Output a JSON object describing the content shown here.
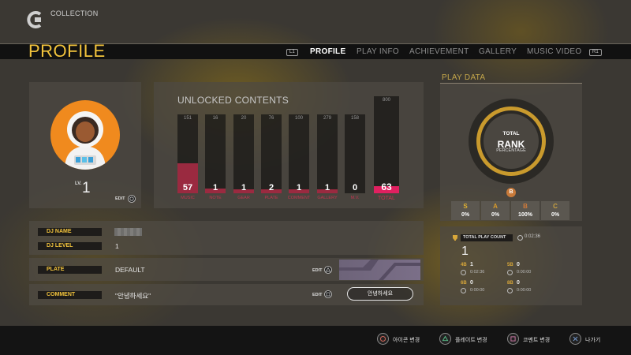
{
  "header": {
    "collection_label": "COLLECTION",
    "page_title": "PROFILE",
    "nav_left_button": "L1",
    "nav_right_button": "R1",
    "tabs": [
      {
        "label": "PROFILE",
        "active": true
      },
      {
        "label": "PLAY INFO",
        "active": false
      },
      {
        "label": "ACHIEVEMENT",
        "active": false
      },
      {
        "label": "GALLERY",
        "active": false
      },
      {
        "label": "MUSIC VIDEO",
        "active": false
      }
    ]
  },
  "profile": {
    "lv_label": "LV.",
    "level": "1",
    "edit_label": "EDIT",
    "avatar_icon": "astronaut-avatar"
  },
  "unlocked": {
    "title": "UNLOCKED CONTENTS",
    "chart_data": {
      "type": "bar",
      "categories": [
        "MUSIC",
        "NOTE",
        "GEAR",
        "PLATE",
        "COMMENT",
        "GALLERY",
        "M.V.",
        "TOTAL"
      ],
      "max_values": [
        151,
        16,
        20,
        76,
        100,
        279,
        158,
        800
      ],
      "values": [
        57,
        1,
        1,
        2,
        1,
        1,
        0,
        63
      ],
      "bar_color": "#9a2a40",
      "total_color": "#e02060"
    }
  },
  "info": {
    "dj_name_label": "DJ NAME",
    "dj_level_label": "DJ LEVEL",
    "dj_level_value": "1",
    "plate_label": "PLATE",
    "plate_value": "DEFAULT",
    "comment_label": "COMMENT",
    "comment_value": "\"안녕하세요\"",
    "comment_bubble": "안녕하세요",
    "edit_label": "EDIT"
  },
  "play_data": {
    "title": "PLAY DATA",
    "rank_total": "TOTAL",
    "rank_rank": "RANK",
    "rank_percentage": "PERCENTAGE",
    "grades": [
      {
        "letter": "S",
        "percent": "0%",
        "color": "#e0b030"
      },
      {
        "letter": "A",
        "percent": "0%",
        "color": "#d89a2a"
      },
      {
        "letter": "B",
        "percent": "100%",
        "color": "#d07a3a"
      },
      {
        "letter": "C",
        "percent": "0%",
        "color": "#c8a040"
      }
    ],
    "total_play_count_label": "TOTAL PLAY COUNT",
    "total_play_time": "0:02:36",
    "total_play_count": "1",
    "buttons": [
      {
        "key": "4B",
        "count": "1",
        "time": "0:02:36"
      },
      {
        "key": "5B",
        "count": "0",
        "time": "0:00:00"
      },
      {
        "key": "6B",
        "count": "0",
        "time": "0:00:00"
      },
      {
        "key": "8B",
        "count": "0",
        "time": "0:00:00"
      }
    ]
  },
  "footer": {
    "actions": [
      {
        "label": "아이콘 변경",
        "icon": "circle-button-icon"
      },
      {
        "label": "플레이트 변경",
        "icon": "triangle-button-icon"
      },
      {
        "label": "코멘트 변경",
        "icon": "square-button-icon"
      },
      {
        "label": "나가기",
        "icon": "cross-button-icon"
      }
    ]
  }
}
